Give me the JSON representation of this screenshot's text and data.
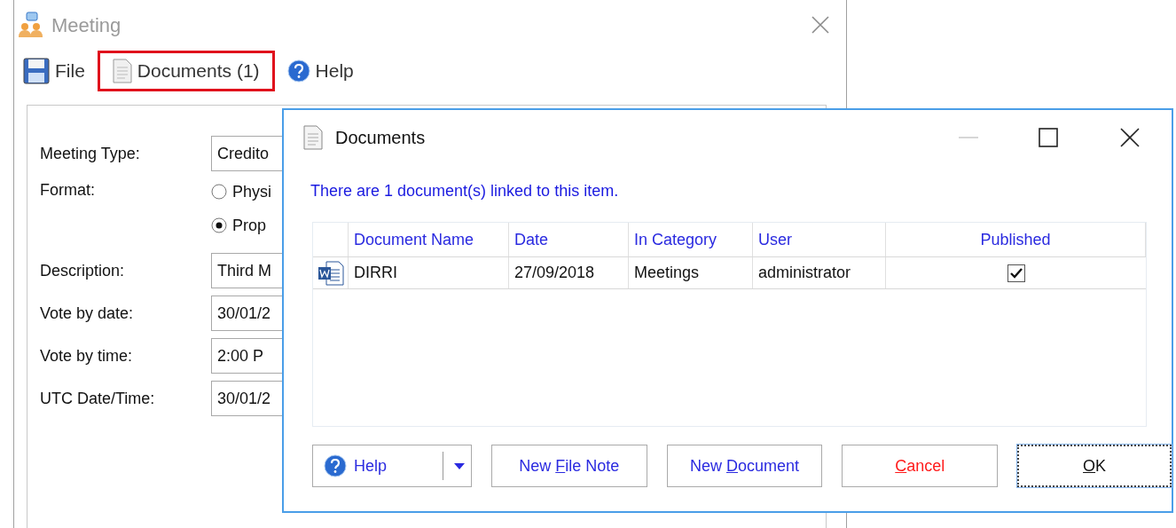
{
  "meeting_window": {
    "title": "Meeting",
    "toolbar": [
      {
        "kind": "file",
        "label": "File",
        "highlighted": false
      },
      {
        "kind": "documents",
        "label": "Documents (1)",
        "highlighted": true
      },
      {
        "kind": "help",
        "label": "Help",
        "highlighted": false
      }
    ],
    "form": [
      {
        "kind": "field",
        "label": "Meeting Type:",
        "value": "Credito"
      },
      {
        "kind": "radio",
        "label": "Format:",
        "options": [
          {
            "label": "Physi",
            "selected": false
          },
          {
            "label": "Prop",
            "selected": true
          }
        ]
      },
      {
        "kind": "field",
        "label": "Description:",
        "value": "Third M"
      },
      {
        "kind": "field",
        "label": "Vote by date:",
        "value": "30/01/2"
      },
      {
        "kind": "field",
        "label": "Vote by time:",
        "value": "2:00 P"
      },
      {
        "kind": "field",
        "label": "UTC Date/Time:",
        "value": "30/01/2"
      }
    ]
  },
  "documents_dialog": {
    "title": "Documents",
    "info": "There are 1 document(s) linked to this item.",
    "table": {
      "columns": [
        "Document Name",
        "Date",
        "In Category",
        "User",
        "Published"
      ],
      "rows": [
        {
          "document_name": "DIRRI",
          "date": "27/09/2018",
          "in_category": "Meetings",
          "user": "administrator",
          "published": true
        }
      ]
    },
    "buttons": [
      {
        "kind": "split",
        "label": "Help"
      },
      {
        "kind": "plain",
        "before": "New ",
        "key": "F",
        "after": "ile Note"
      },
      {
        "kind": "plain",
        "before": "New ",
        "key": "D",
        "after": "ocument"
      },
      {
        "kind": "cancel",
        "key": "C",
        "after": "ancel"
      },
      {
        "kind": "default",
        "key": "O",
        "after": "K"
      }
    ]
  }
}
